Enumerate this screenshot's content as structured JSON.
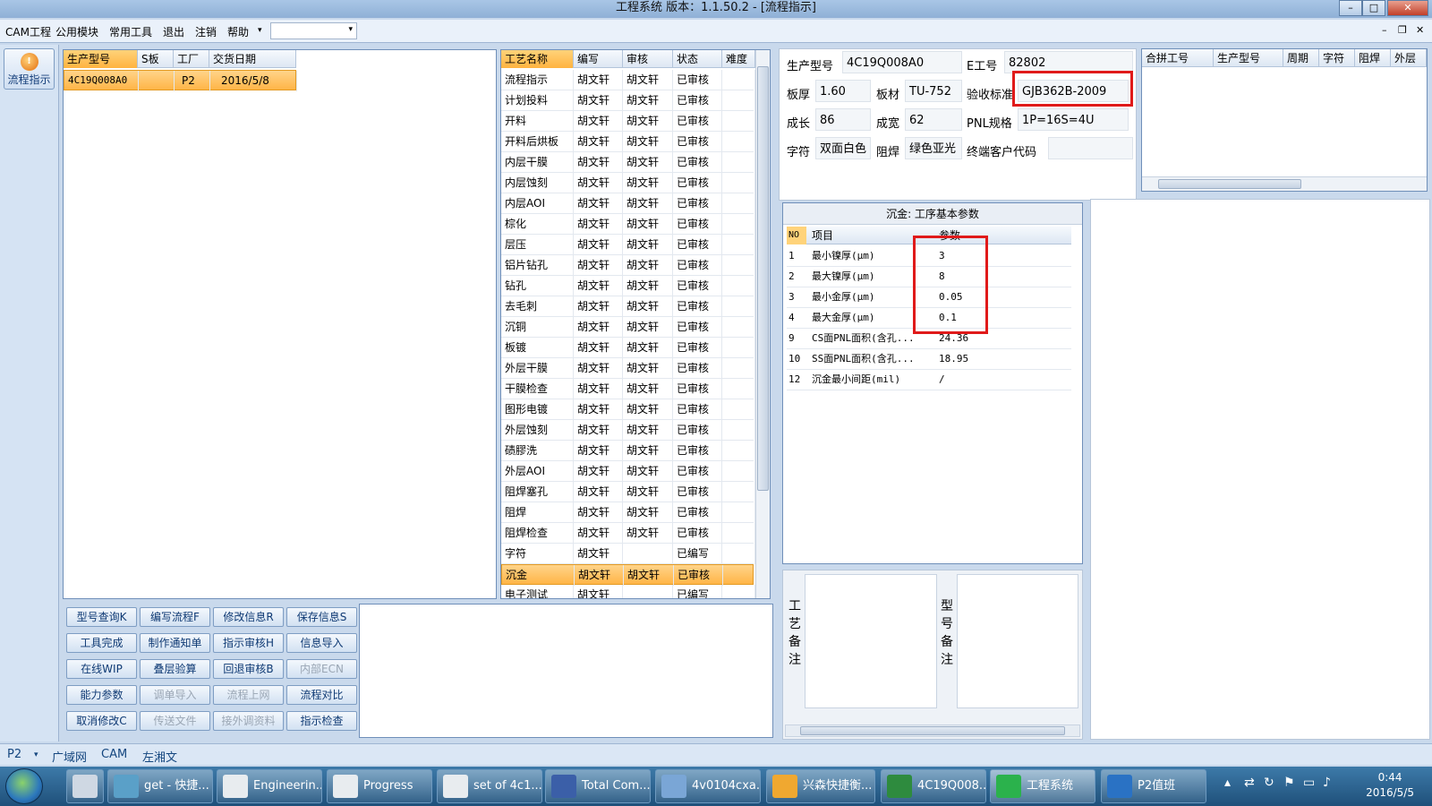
{
  "window": {
    "title": "工程系统   版本：1.1.50.2 - [流程指示]",
    "btn_min": "–",
    "btn_max": "□",
    "btn_close": "✕"
  },
  "menu": {
    "items": [
      "CAM工程",
      "公用模块",
      "常用工具",
      "退出",
      "注销",
      "帮助"
    ],
    "help_arrow": "▾",
    "combo_value": "",
    "combo_arrow": "▾",
    "mdi_min": "–",
    "mdi_restore": "❐",
    "mdi_close": "✕"
  },
  "sidebar": {
    "flow_button": "流程指示",
    "flow_icon_glyph": "!"
  },
  "orders": {
    "columns": [
      "生产型号",
      "S板",
      "工厂",
      "交货日期"
    ],
    "rows": [
      {
        "model": "4C19Q008A0",
        "s": "",
        "factory": "P2",
        "date": "2016/5/8"
      }
    ]
  },
  "process": {
    "columns": [
      "工艺名称",
      "编写",
      "审核",
      "状态",
      "难度"
    ],
    "rows": [
      {
        "name": "流程指示",
        "author": "胡文轩",
        "reviewer": "胡文轩",
        "status": "已审核"
      },
      {
        "name": "计划投料",
        "author": "胡文轩",
        "reviewer": "胡文轩",
        "status": "已审核"
      },
      {
        "name": "开料",
        "author": "胡文轩",
        "reviewer": "胡文轩",
        "status": "已审核"
      },
      {
        "name": "开料后烘板",
        "author": "胡文轩",
        "reviewer": "胡文轩",
        "status": "已审核"
      },
      {
        "name": "内层干膜",
        "author": "胡文轩",
        "reviewer": "胡文轩",
        "status": "已审核"
      },
      {
        "name": "内层蚀刻",
        "author": "胡文轩",
        "reviewer": "胡文轩",
        "status": "已审核"
      },
      {
        "name": "内层AOI",
        "author": "胡文轩",
        "reviewer": "胡文轩",
        "status": "已审核"
      },
      {
        "name": "棕化",
        "author": "胡文轩",
        "reviewer": "胡文轩",
        "status": "已审核"
      },
      {
        "name": "层压",
        "author": "胡文轩",
        "reviewer": "胡文轩",
        "status": "已审核"
      },
      {
        "name": "铝片钻孔",
        "author": "胡文轩",
        "reviewer": "胡文轩",
        "status": "已审核"
      },
      {
        "name": "钻孔",
        "author": "胡文轩",
        "reviewer": "胡文轩",
        "status": "已审核"
      },
      {
        "name": "去毛刺",
        "author": "胡文轩",
        "reviewer": "胡文轩",
        "status": "已审核"
      },
      {
        "name": "沉铜",
        "author": "胡文轩",
        "reviewer": "胡文轩",
        "status": "已审核"
      },
      {
        "name": "板镀",
        "author": "胡文轩",
        "reviewer": "胡文轩",
        "status": "已审核"
      },
      {
        "name": "外层干膜",
        "author": "胡文轩",
        "reviewer": "胡文轩",
        "status": "已审核"
      },
      {
        "name": "干膜检查",
        "author": "胡文轩",
        "reviewer": "胡文轩",
        "status": "已审核"
      },
      {
        "name": "图形电镀",
        "author": "胡文轩",
        "reviewer": "胡文轩",
        "status": "已审核"
      },
      {
        "name": "外层蚀刻",
        "author": "胡文轩",
        "reviewer": "胡文轩",
        "status": "已审核"
      },
      {
        "name": "碛膠洗",
        "author": "胡文轩",
        "reviewer": "胡文轩",
        "status": "已审核"
      },
      {
        "name": "外层AOI",
        "author": "胡文轩",
        "reviewer": "胡文轩",
        "status": "已审核"
      },
      {
        "name": "阻焊塞孔",
        "author": "胡文轩",
        "reviewer": "胡文轩",
        "status": "已审核"
      },
      {
        "name": "阻焊",
        "author": "胡文轩",
        "reviewer": "胡文轩",
        "status": "已审核"
      },
      {
        "name": "阻焊检查",
        "author": "胡文轩",
        "reviewer": "胡文轩",
        "status": "已审核"
      },
      {
        "name": "字符",
        "author": "胡文轩",
        "reviewer": "",
        "status": "已编写"
      },
      {
        "name": "沉金",
        "author": "胡文轩",
        "reviewer": "胡文轩",
        "status": "已审核"
      },
      {
        "name": "电子测试",
        "author": "胡文轩",
        "reviewer": "",
        "status": "已编写"
      }
    ]
  },
  "info": {
    "model_label": "生产型号",
    "model": "4C19Q008A0",
    "eng_label": "E工号",
    "eng": "82802",
    "thick_label": "板厚",
    "thick": "1.60",
    "material_label": "板材",
    "material": "TU-752",
    "std_label": "验收标准",
    "std": "GJB362B-2009",
    "len_label": "成长",
    "len": "86",
    "wid_label": "成宽",
    "wid": "62",
    "pnl_label": "PNL规格",
    "pnl": "1P=16S=4U",
    "char_label": "字符",
    "char": "双面白色",
    "mask_label": "阻焊",
    "mask": "绿色亚光",
    "cust_label": "终端客户代码",
    "cust": ""
  },
  "merge": {
    "columns": [
      "合拼工号",
      "生产型号",
      "周期",
      "字符",
      "阻焊",
      "外层"
    ]
  },
  "params": {
    "title": "沉金: 工序基本参数",
    "columns": [
      "NO",
      "项目",
      "参数"
    ],
    "rows": [
      {
        "no": "1",
        "item": "最小镍厚(μm)",
        "value": "3"
      },
      {
        "no": "2",
        "item": "最大镍厚(μm)",
        "value": "8"
      },
      {
        "no": "3",
        "item": "最小金厚(μm)",
        "value": "0.05"
      },
      {
        "no": "4",
        "item": "最大金厚(μm)",
        "value": "0.1"
      },
      {
        "no": "9",
        "item": "CS面PNL面积(含孔...",
        "value": "24.36"
      },
      {
        "no": "10",
        "item": "SS面PNL面积(含孔...",
        "value": "18.95"
      },
      {
        "no": "12",
        "item": "沉金最小间距(mil)",
        "value": "/"
      }
    ]
  },
  "notes": {
    "process_label": [
      "工",
      "艺",
      "备",
      "注"
    ],
    "model_label": [
      "型",
      "号",
      "备",
      "注"
    ]
  },
  "buttons": [
    {
      "label": "型号查询K",
      "disabled": false
    },
    {
      "label": "编写流程F",
      "disabled": false
    },
    {
      "label": "修改信息R",
      "disabled": false
    },
    {
      "label": "保存信息S",
      "disabled": false
    },
    {
      "label": "工具完成",
      "disabled": false
    },
    {
      "label": "制作通知单",
      "disabled": false
    },
    {
      "label": "指示审核H",
      "disabled": false
    },
    {
      "label": "信息导入",
      "disabled": false
    },
    {
      "label": "在线WIP",
      "disabled": false
    },
    {
      "label": "叠层验算",
      "disabled": false
    },
    {
      "label": "回退审核B",
      "disabled": false
    },
    {
      "label": "内部ECN",
      "disabled": true
    },
    {
      "label": "能力参数",
      "disabled": false
    },
    {
      "label": "调单导入",
      "disabled": true
    },
    {
      "label": "流程上网",
      "disabled": true
    },
    {
      "label": "流程对比",
      "disabled": false
    },
    {
      "label": "取消修改C",
      "disabled": false
    },
    {
      "label": "传送文件",
      "disabled": true
    },
    {
      "label": "接外调资料",
      "disabled": true
    },
    {
      "label": "指示检查",
      "disabled": false
    }
  ],
  "status": {
    "site": "P2",
    "site_arrow": "▾",
    "network": "广域网",
    "dept": "CAM",
    "user": "左湘文"
  },
  "taskbar": {
    "items": [
      {
        "label": "",
        "color": "#cfd8e3"
      },
      {
        "label": "get - 快捷...",
        "color": "#5aa0c8"
      },
      {
        "label": "Engineerin...",
        "color": "#e8ecef"
      },
      {
        "label": "Progress",
        "color": "#e8ecef"
      },
      {
        "label": "set of 4c1...",
        "color": "#e8ecef"
      },
      {
        "label": "Total Com...",
        "color": "#3b5fa8"
      },
      {
        "label": "4v0104cxa...",
        "color": "#7aa6d6"
      },
      {
        "label": "兴森快捷衡...",
        "color": "#f0a830"
      },
      {
        "label": "4C19Q008...",
        "color": "#2e8b3e"
      },
      {
        "label": "工程系统",
        "color": "#2bb24c"
      },
      {
        "label": "P2值班",
        "color": "#2a72c4"
      }
    ],
    "time": "0:44",
    "date": "2016/5/5"
  },
  "colors": {
    "accent": "#ffb547",
    "red_highlight": "#e01a1a"
  }
}
